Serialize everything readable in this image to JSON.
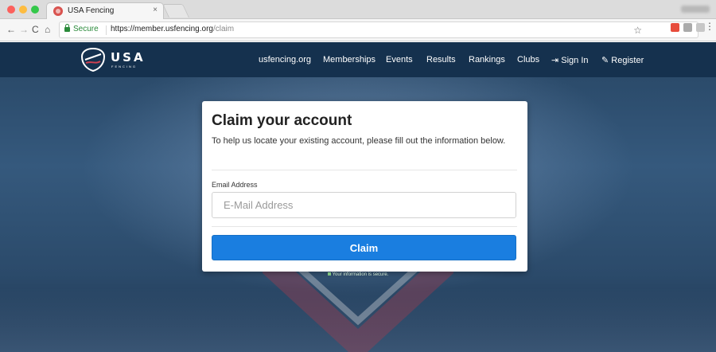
{
  "browser": {
    "tab_title": "USA Fencing",
    "tab_close": "×",
    "secure_label": "Secure",
    "url_base": "https://member.usfencing.org",
    "url_path": "/claim"
  },
  "nav": {
    "logo_word": "USA",
    "logo_sub": "FENCING",
    "links": [
      "usfencing.org",
      "Memberships",
      "Events",
      "Results",
      "Rankings",
      "Clubs"
    ],
    "sign_in": "Sign In",
    "register": "Register"
  },
  "card": {
    "title": "Claim your account",
    "description": "To help us locate your existing account, please fill out the information below.",
    "email_label": "Email Address",
    "email_placeholder": "E-Mail Address",
    "email_value": "",
    "claim_label": "Claim",
    "secure_note": "Your information is secure."
  },
  "colors": {
    "navbar": "#15314e",
    "accent": "#1a7ee0",
    "secure_green": "#2a8a3a"
  },
  "icons": {
    "back": "←",
    "forward": "→",
    "reload": "C",
    "home": "⌂",
    "star": "☆",
    "menu": "⋮",
    "sign_in": "⇥",
    "register": "✎"
  }
}
